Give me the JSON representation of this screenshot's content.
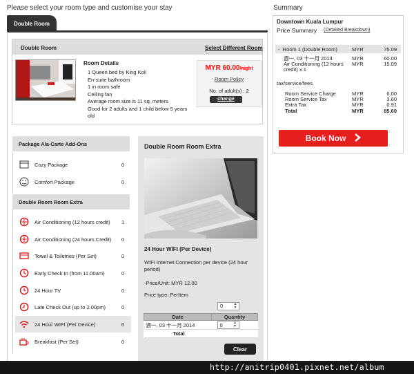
{
  "header": {
    "title": "Please select your room type and customise your stay",
    "summary_title": "Summary"
  },
  "tab": {
    "label": "Double Room"
  },
  "room": {
    "title": "Double Room",
    "select_link": "Select Different Room",
    "details_label": "Room Details",
    "details": [
      "1 Queen bed by King Koil",
      "En-suite bathroom",
      "1 in room safe",
      "Ceiling fan",
      "Average room size is 11 sq. meters",
      "Good for 2 adults and 1 child below 5 years old"
    ],
    "price": "MYR 60.00",
    "price_unit": "/night",
    "policy_link": "Room Policy",
    "adults_label": "No. of adult(s) : 2",
    "change_label": "change"
  },
  "package_addons": {
    "title": "Package Ala-Carte Add-Ons",
    "items": [
      {
        "label": "Cozy Package",
        "qty": "0",
        "icon": "calendar-icon"
      },
      {
        "label": "Comfort Package",
        "qty": "0",
        "icon": "smiley-icon"
      }
    ]
  },
  "room_extra": {
    "title": "Double Room Room Extra",
    "items": [
      {
        "label": "Air Conditioning (12 hours credit)",
        "qty": "1",
        "icon": "aircon-icon"
      },
      {
        "label": "Air Conditioning (24 hours Credit)",
        "qty": "0",
        "icon": "aircon-icon"
      },
      {
        "label": "Towel & Toiletries (Per Set)",
        "qty": "0",
        "icon": "towel-icon"
      },
      {
        "label": "Early Check In (from 11.00am)",
        "qty": "0",
        "icon": "clock-icon"
      },
      {
        "label": "24 Hour TV",
        "qty": "0",
        "icon": "tv-icon"
      },
      {
        "label": "Late Check Out (up to 2.00pm)",
        "qty": "0",
        "icon": "clock-icon"
      },
      {
        "label": "24 Hour WIFI (Per Device)",
        "qty": "0",
        "icon": "wifi-icon"
      },
      {
        "label": "Breakfast (Per Set)",
        "qty": "0",
        "icon": "breakfast-icon"
      }
    ]
  },
  "extra_panel": {
    "title": "Double Room Room Extra",
    "item_title": "24 Hour WIFI (Per Device)",
    "description": "WIFI Internet Connection per device (24 hour period)",
    "price_unit": "-Price/Unit: MYR 12.00",
    "price_type": "Price type: PerItem",
    "qty_top": "0",
    "table": {
      "headers": [
        "Date",
        "Quantity"
      ],
      "row_date": "週一, 03 十一月 2014",
      "row_qty": "0",
      "total_label": "Total"
    },
    "clear_label": "Clear"
  },
  "summary": {
    "hotel": "Downtown Kuala Lumpur",
    "price_summary": "Price Summary",
    "breakdown_link": "(Detailed Breakdown)",
    "room_line": {
      "label": "Room 1 (Double Room)",
      "cur": "MYR",
      "amount": "75.09"
    },
    "date_line": {
      "label": "週一, 03 十一月 2014",
      "cur": "MYR",
      "amount": "60.00"
    },
    "aircon_line": {
      "label": "Air Conditioning (12 hours credit) x 1",
      "cur": "MYR",
      "amount": "15.09"
    },
    "tax_label": "tax/service/fees",
    "tax_lines": [
      {
        "label": "Room Service Charge",
        "cur": "MYR",
        "amount": "6.00"
      },
      {
        "label": "Room Service Tax",
        "cur": "MYR",
        "amount": "3.60"
      },
      {
        "label": "Extra Tax",
        "cur": "MYR",
        "amount": "0.91"
      }
    ],
    "total": {
      "label": "Total",
      "cur": "MYR",
      "amount": "85.60"
    },
    "book_label": "Book Now"
  },
  "watermark": "http://anitrip0401.pixnet.net/album",
  "colors": {
    "accent": "#e61e1e",
    "dark": "#333333",
    "header_bg": "#dddddd"
  }
}
